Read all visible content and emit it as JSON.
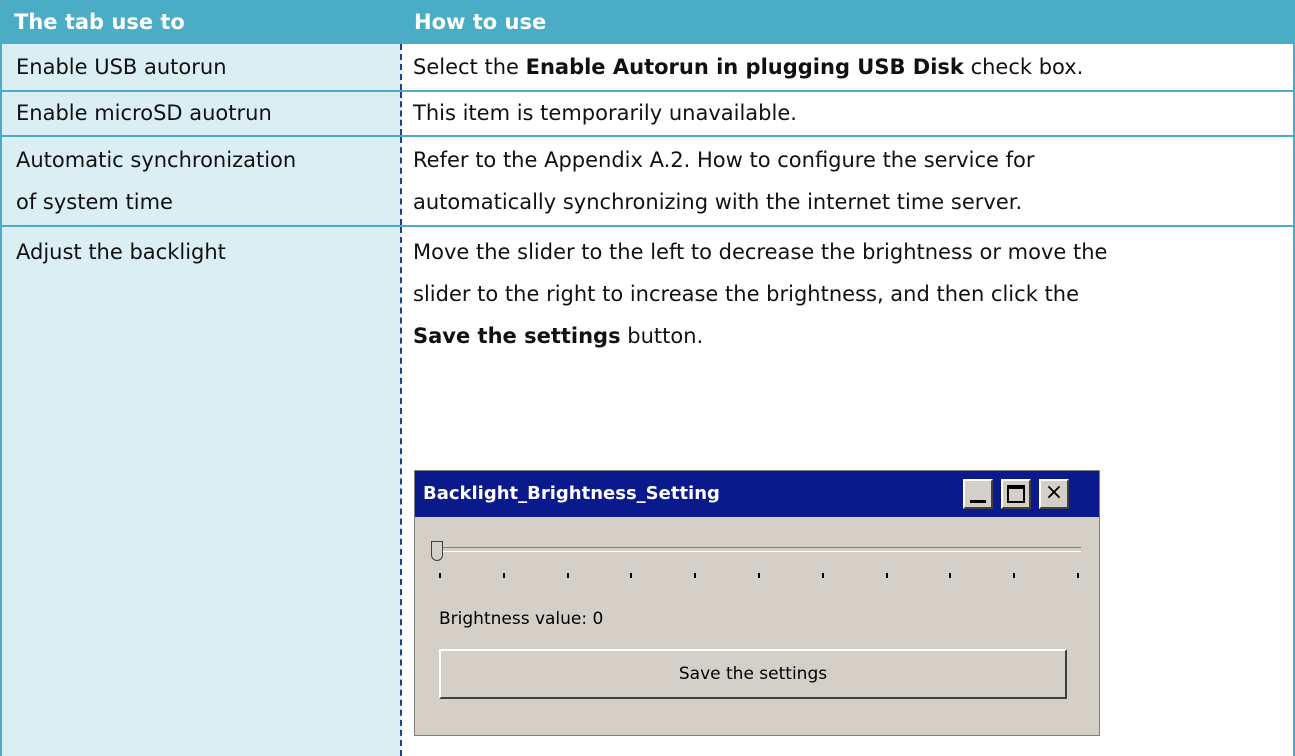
{
  "header": {
    "col1": "The tab use to",
    "col2": "How to use"
  },
  "rows": [
    {
      "col1": "Enable USB autorun",
      "col2_pre": "Select the ",
      "col2_bold": "Enable Autorun in plugging USB Disk",
      "col2_post": " check box."
    },
    {
      "col1": "Enable microSD auotrun",
      "col2": "This item is temporarily unavailable."
    },
    {
      "col1_line1": "Automatic synchronization",
      "col1_line2": "of system time",
      "col2_line1": "Refer to the Appendix A.2. How to configure the service for",
      "col2_line2": "automatically synchronizing with the internet time server."
    },
    {
      "col1": "Adjust the backlight",
      "col2_line1": "Move the slider to the left to decrease the brightness or move the",
      "col2_line2": "slider to the right to increase the brightness, and then click the",
      "col2_bold": "Save the settings",
      "col2_post": " button."
    }
  ],
  "dialog": {
    "title": "Backlight_Brightness_Setting",
    "minimize_icon": "minimize-icon",
    "maximize_icon": "maximize-icon",
    "close_icon": "close-icon",
    "close_glyph": "×",
    "slider_value": 0,
    "brightness_label": "Brightness value: 0",
    "save_button": "Save the settings"
  },
  "colors": {
    "header_bg": "#4bacc6",
    "first_col_bg": "#daeef3",
    "titlebar_bg": "#0a1a8c",
    "dialog_bg": "#d4d0c8"
  }
}
